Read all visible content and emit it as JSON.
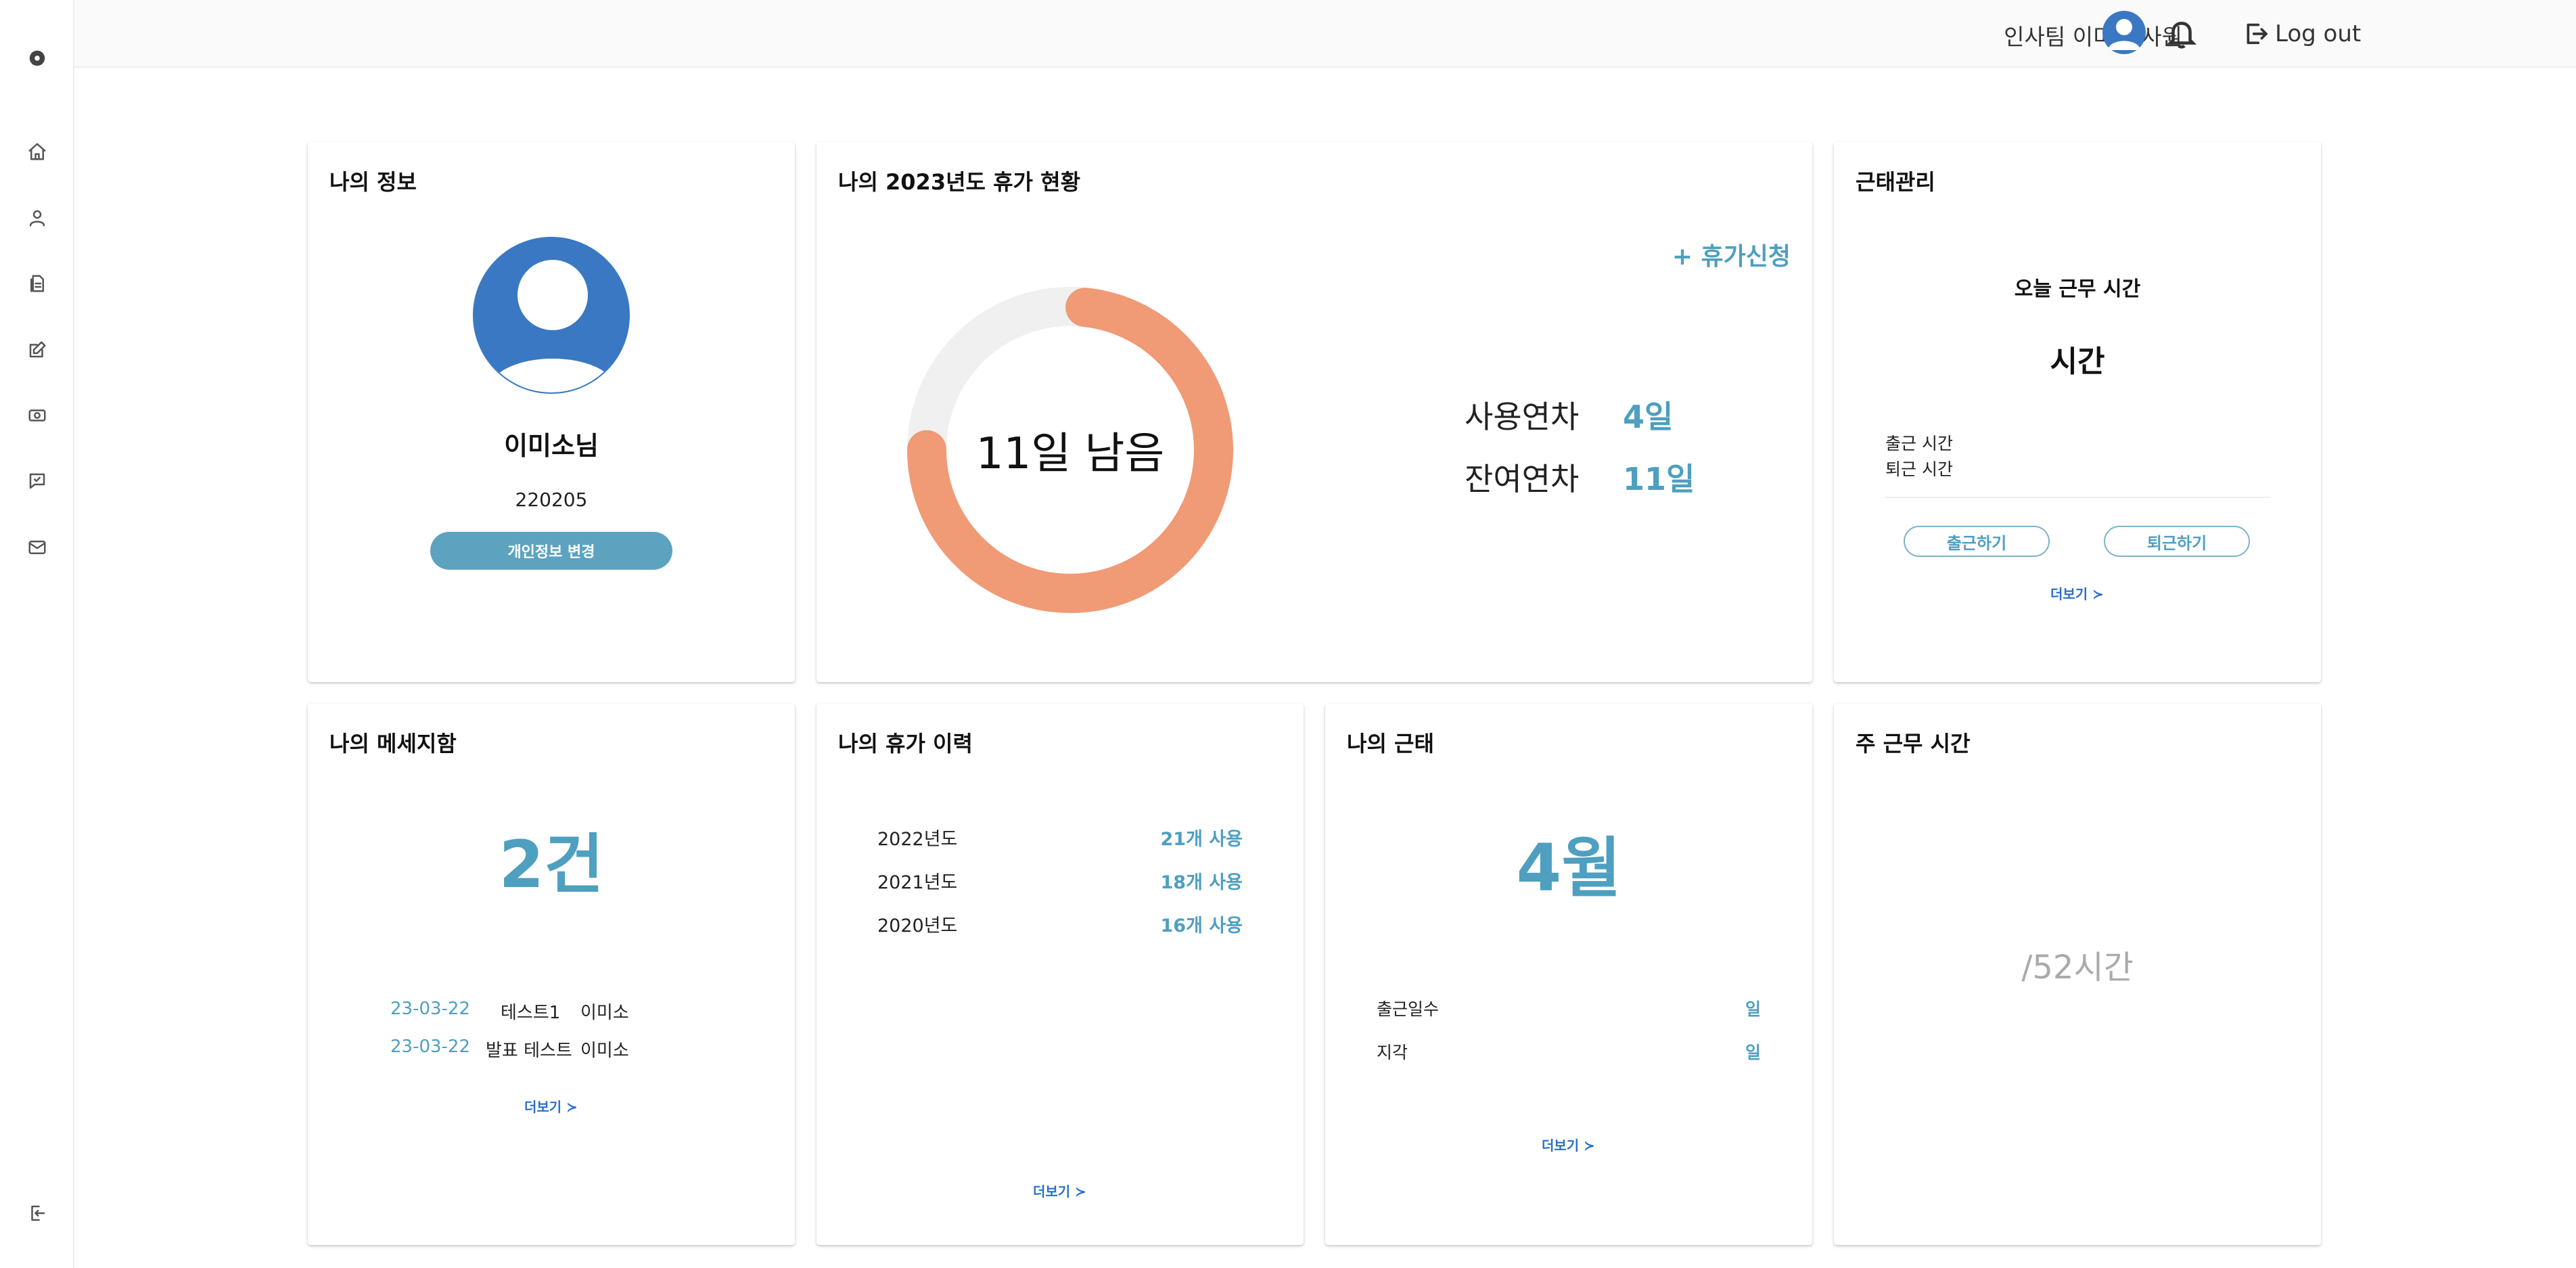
{
  "header": {
    "user_text": "인사팀  이미소 사원",
    "logout_label": "Log out"
  },
  "sidebar": {
    "items": [
      {
        "icon": "disc-icon"
      },
      {
        "icon": "home-icon"
      },
      {
        "icon": "user-icon"
      },
      {
        "icon": "document-icon"
      },
      {
        "icon": "edit-icon"
      },
      {
        "icon": "money-icon"
      },
      {
        "icon": "chat-icon"
      },
      {
        "icon": "mail-icon"
      },
      {
        "icon": "logout-icon"
      }
    ]
  },
  "my_info": {
    "title": "나의 정보",
    "name": "이미소님",
    "employee_id": "220205",
    "edit_button": "개인정보 변경"
  },
  "vacation_status": {
    "title": "나의 2023년도 휴가 현황",
    "apply_link": "+ 휴가신청",
    "remaining_text": "11일 남음",
    "used_label": "사용연차",
    "used_value": "4일",
    "remaining_label": "잔여연차",
    "remaining_value": "11일",
    "used_days": 4,
    "total_days": 15,
    "colors": {
      "remaining": "#f09a76",
      "used": "#f0f0f0"
    }
  },
  "attendance": {
    "title": "근태관리",
    "today_label": "오늘 근무 시간",
    "time_value": "시간",
    "clock_in_label": "출근 시간",
    "clock_out_label": "퇴근 시간",
    "clock_in_button": "출근하기",
    "clock_out_button": "퇴근하기",
    "more": "더보기 ≻"
  },
  "messages": {
    "title": "나의 메세지함",
    "count": "2건",
    "items": [
      {
        "date": "23-03-22",
        "subject": "테스트1",
        "sender": "이미소"
      },
      {
        "date": "23-03-22",
        "subject": "발표 테스트",
        "sender": "이미소"
      }
    ],
    "more": "더보기 ≻"
  },
  "vacation_history": {
    "title": "나의 휴가 이력",
    "rows": [
      {
        "year": "2022년도",
        "used": "21개 사용"
      },
      {
        "year": "2021년도",
        "used": "18개 사용"
      },
      {
        "year": "2020년도",
        "used": "16개 사용"
      }
    ],
    "more": "더보기 ≻"
  },
  "my_attendance": {
    "title": "나의 근태",
    "month": "4월",
    "rows": [
      {
        "label": "출근일수",
        "value": "일"
      },
      {
        "label": "지각",
        "value": "일"
      }
    ],
    "more": "더보기 ≻"
  },
  "weekly_hours": {
    "title": "주 근무 시간",
    "value": "/52시간"
  },
  "colors": {
    "accent": "#4e9fc0",
    "profile_blue": "#3a78c3",
    "link_blue": "#2a6fc9",
    "donut_orange": "#f09a76"
  }
}
